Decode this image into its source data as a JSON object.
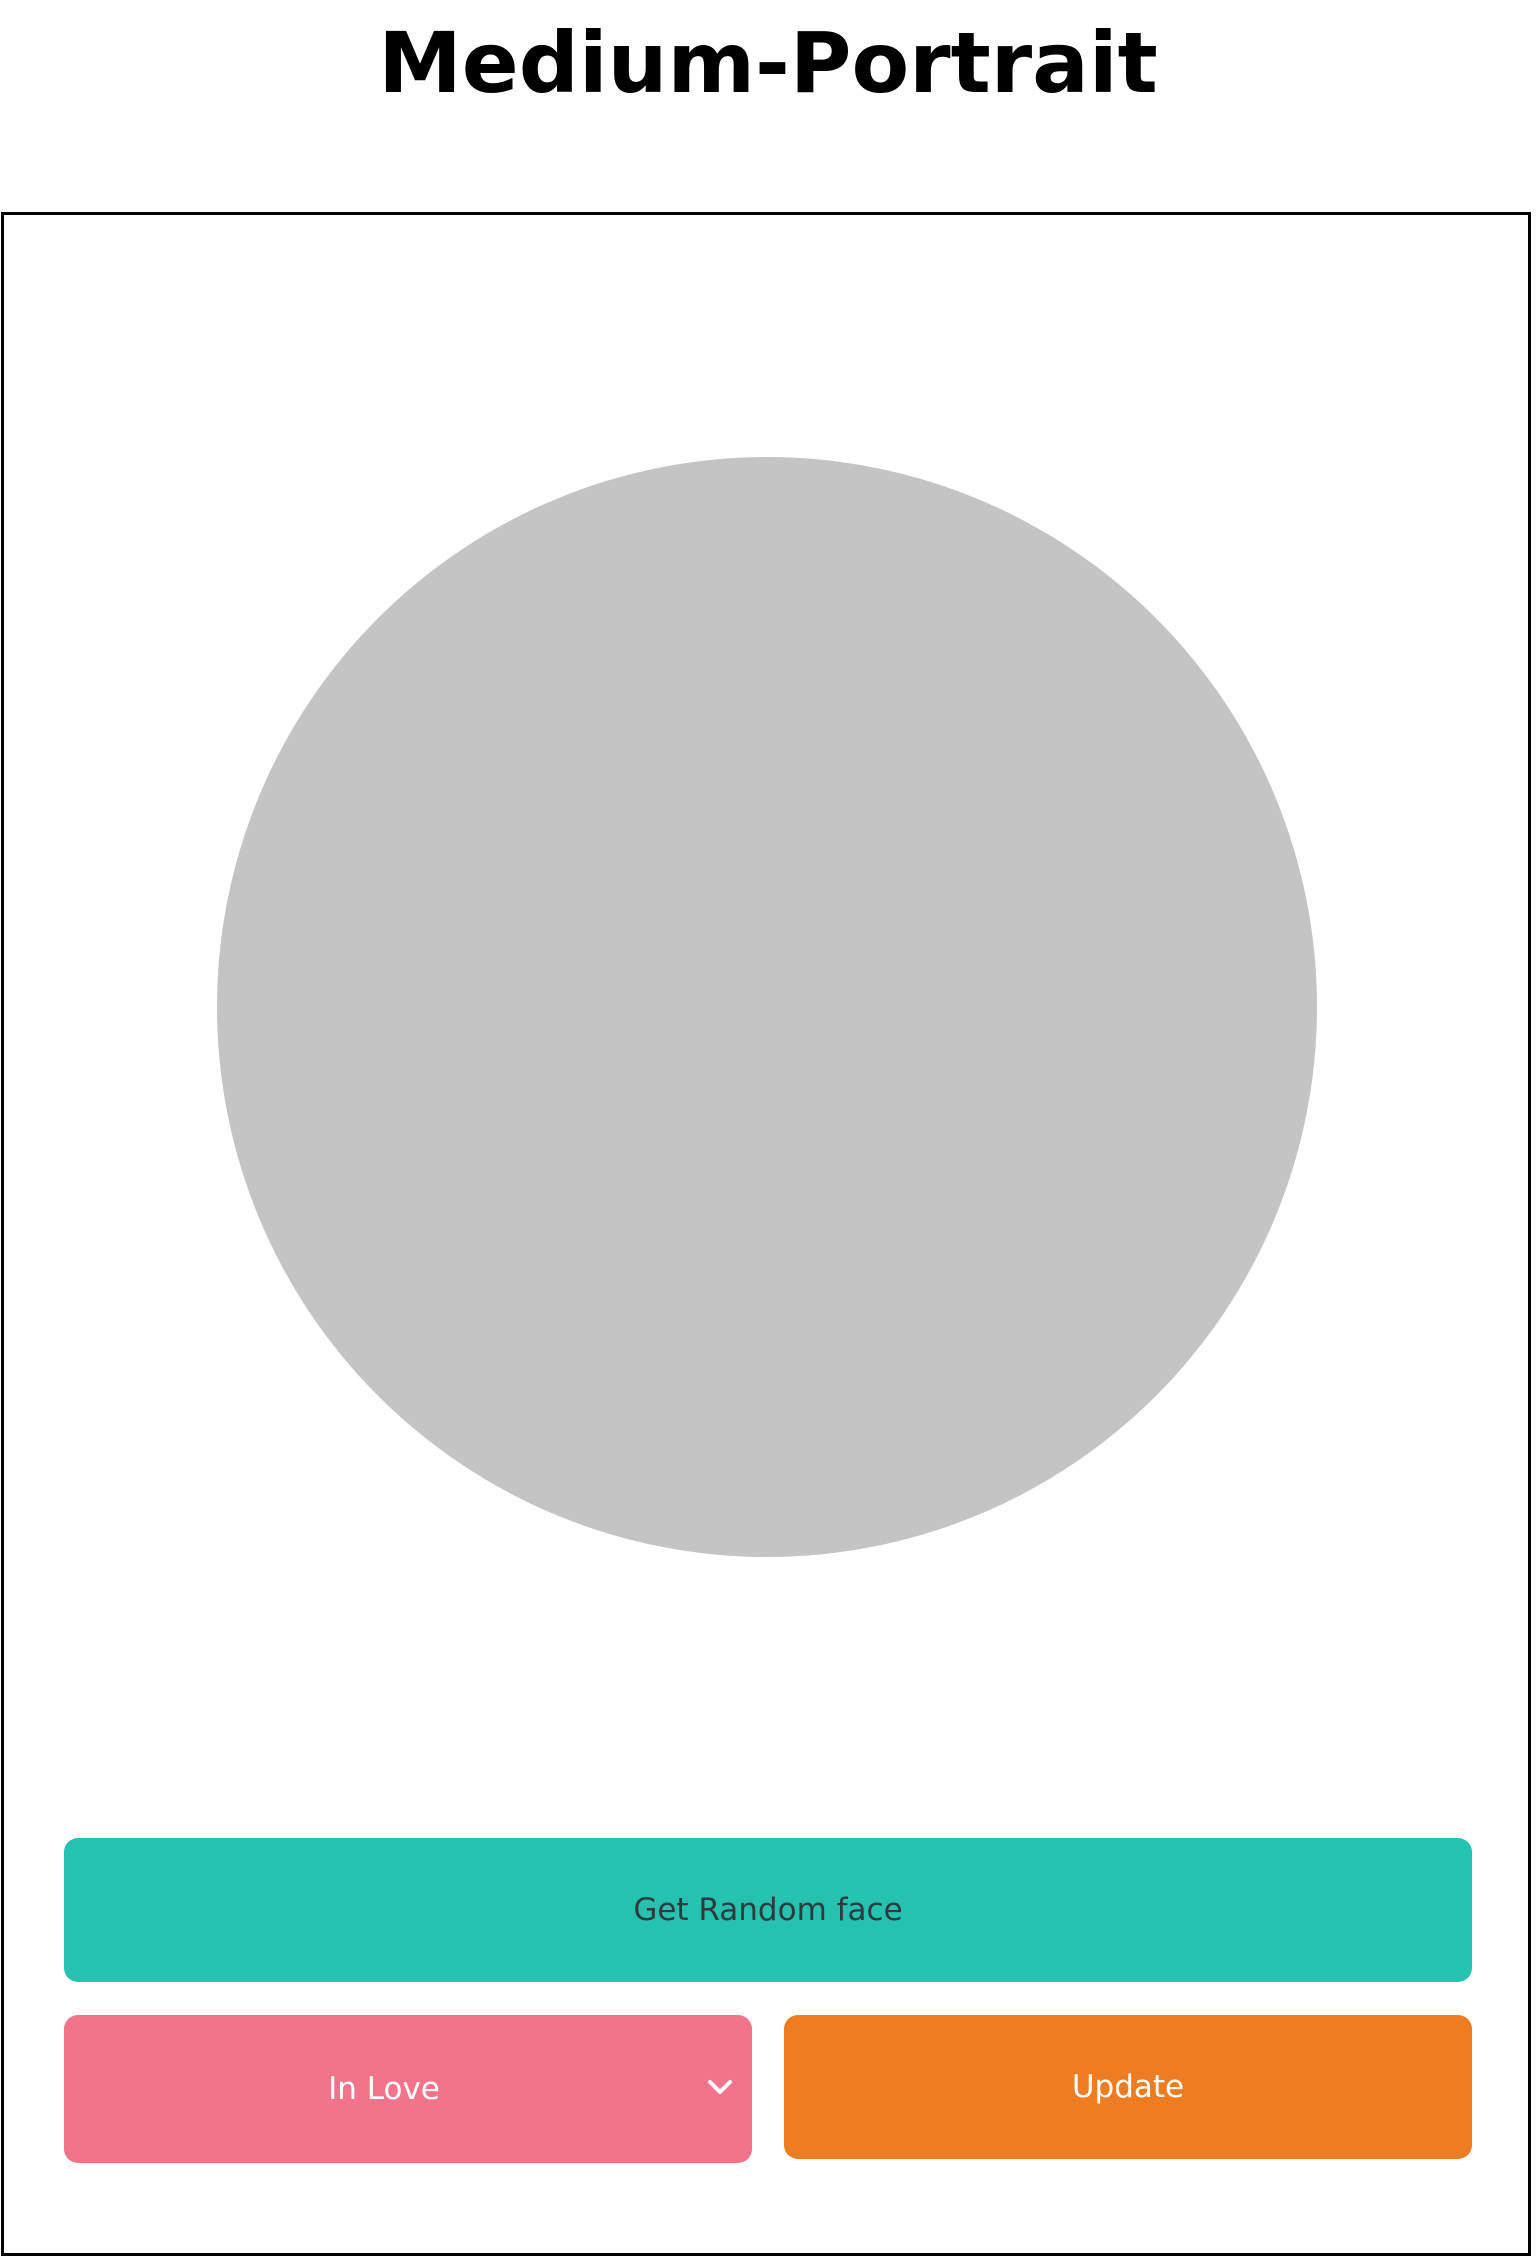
{
  "header": {
    "title": "Medium-Portrait"
  },
  "controls": {
    "random_label": "Get Random face",
    "mood_selected": "In Love",
    "update_label": "Update"
  },
  "icons": {
    "dropdown": "chevron-down-icon"
  },
  "colors": {
    "face_placeholder": "#c4c4c4",
    "random_button": "#26c2b0",
    "mood_select": "#f2748a",
    "update_button": "#ee7c22"
  }
}
